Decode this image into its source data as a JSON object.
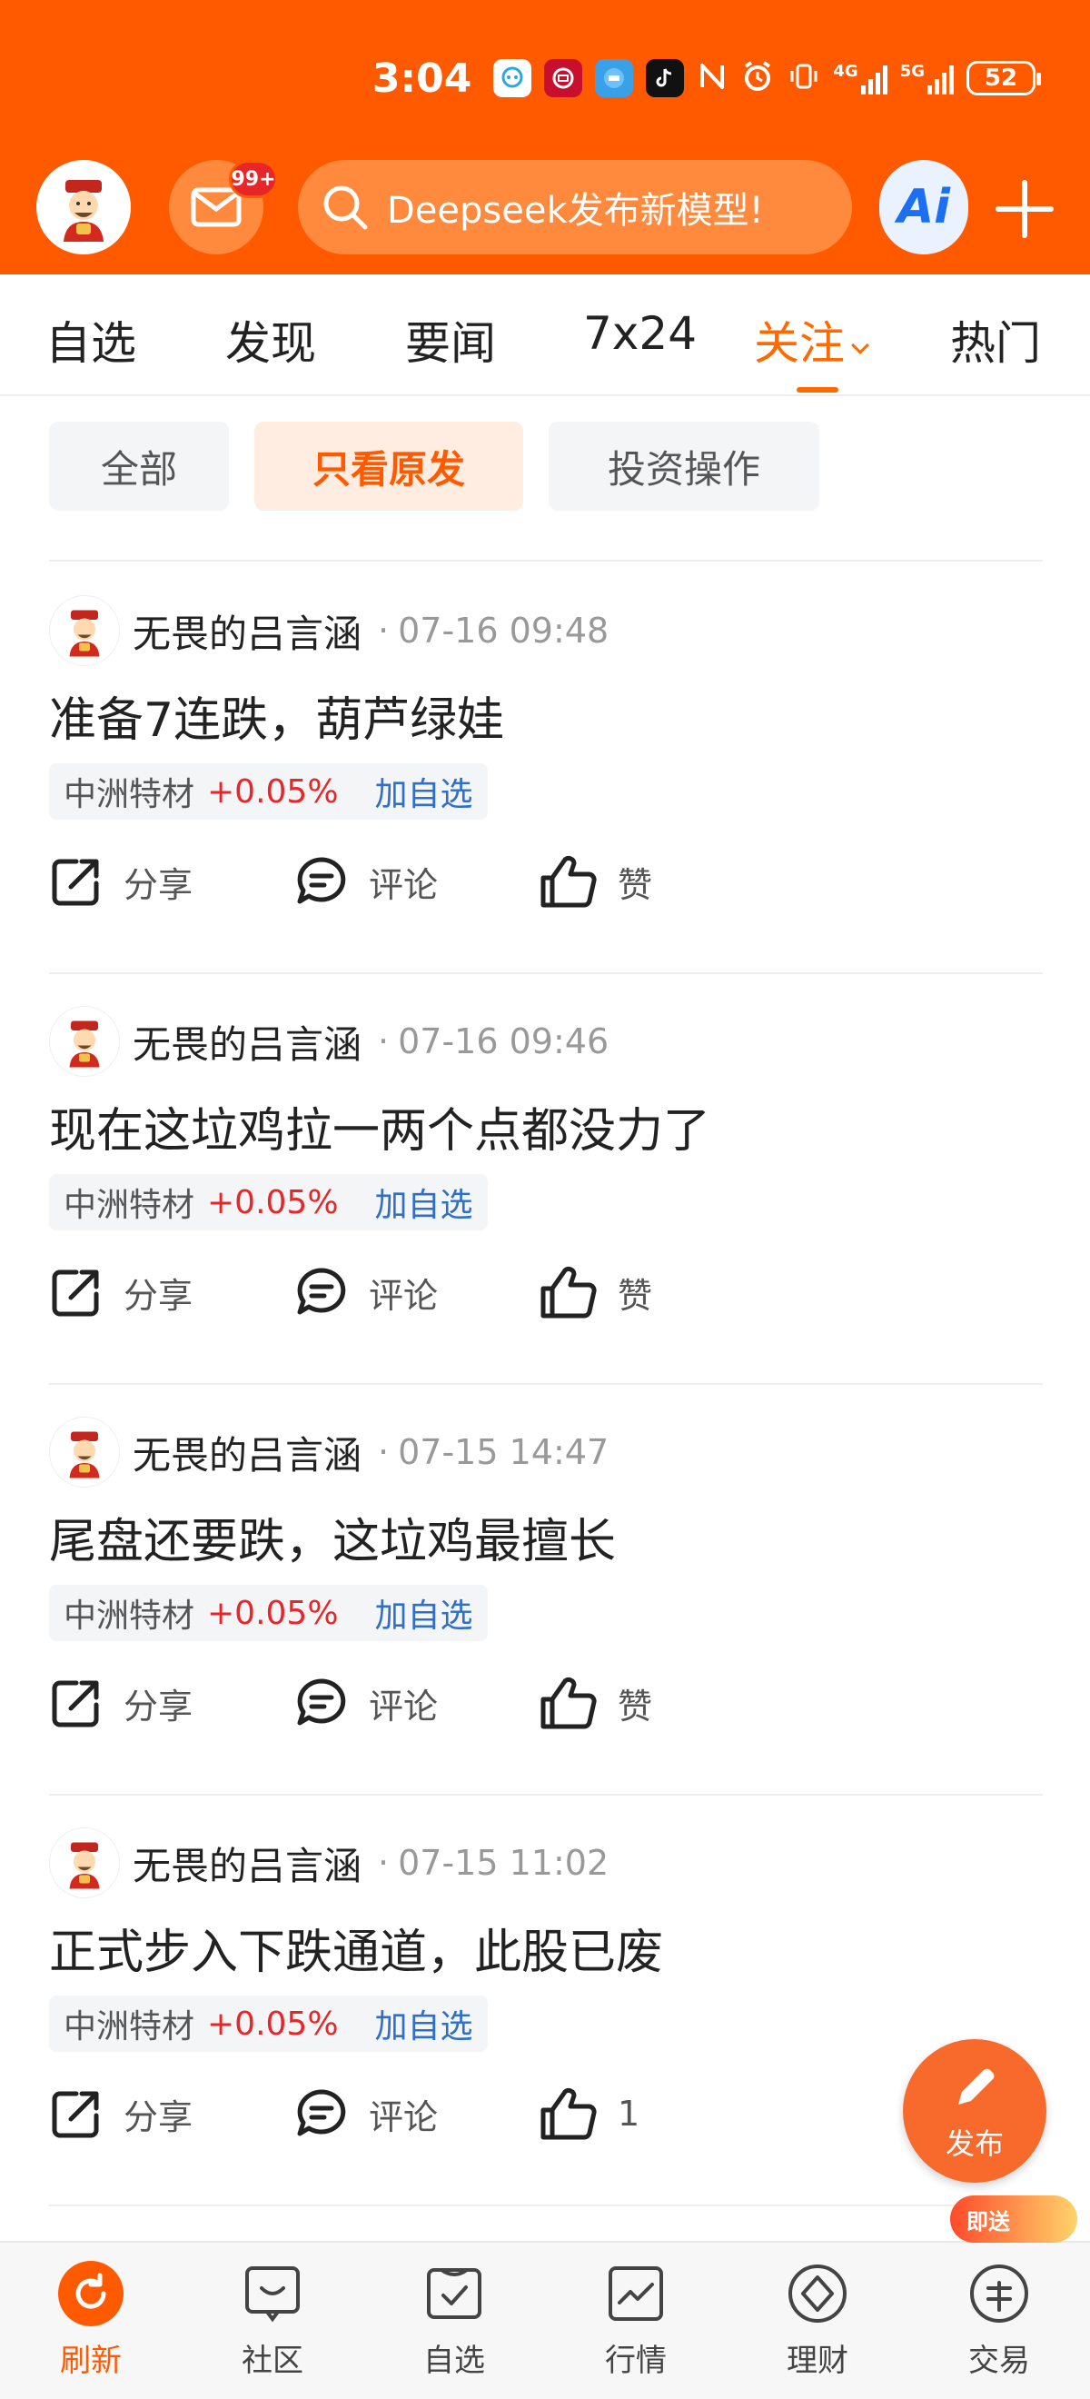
{
  "status_bar": {
    "time": "3:04",
    "network": "4G",
    "network2": "5G",
    "battery": "52"
  },
  "header": {
    "mail_badge": "99+",
    "search_placeholder": "Deepseek发布新模型!",
    "ai_label": "Ai"
  },
  "tabs": [
    {
      "label": "自选"
    },
    {
      "label": "发现"
    },
    {
      "label": "要闻"
    },
    {
      "label": "7x24"
    },
    {
      "label": "关注"
    },
    {
      "label": "热门"
    }
  ],
  "filters": [
    {
      "label": "全部"
    },
    {
      "label": "只看原发"
    },
    {
      "label": "投资操作"
    }
  ],
  "posts": [
    {
      "author": "无畏的吕言涵",
      "time": "07-16 09:48",
      "title": "准备7连跌，葫芦绿娃",
      "stock": "中洲特材",
      "change": "+0.05%",
      "add": "加自选",
      "share": "分享",
      "comment": "评论",
      "like": "赞"
    },
    {
      "author": "无畏的吕言涵",
      "time": "07-16 09:46",
      "title": "现在这垃鸡拉一两个点都没力了",
      "stock": "中洲特材",
      "change": "+0.05%",
      "add": "加自选",
      "share": "分享",
      "comment": "评论",
      "like": "赞"
    },
    {
      "author": "无畏的吕言涵",
      "time": "07-15 14:47",
      "title": "尾盘还要跌，这垃鸡最擅长",
      "stock": "中洲特材",
      "change": "+0.05%",
      "add": "加自选",
      "share": "分享",
      "comment": "评论",
      "like": "赞"
    },
    {
      "author": "无畏的吕言涵",
      "time": "07-15 11:02",
      "title": "正式步入下跌通道，此股已废",
      "stock": "中洲特材",
      "change": "+0.05%",
      "add": "加自选",
      "share": "分享",
      "comment": "评论",
      "like": "1"
    }
  ],
  "fab": {
    "label": "发布"
  },
  "bottom_nav": [
    {
      "label": "刷新",
      "icon": "refresh-icon"
    },
    {
      "label": "社区",
      "icon": "community-icon"
    },
    {
      "label": "自选",
      "icon": "watchlist-icon"
    },
    {
      "label": "行情",
      "icon": "market-icon"
    },
    {
      "label": "理财",
      "icon": "finance-icon"
    },
    {
      "label": "交易",
      "icon": "trade-icon"
    }
  ],
  "promo_badge": "即送",
  "colors": {
    "brand": "#ff5a00",
    "rise": "#e8262a",
    "link": "#2f6fc9"
  }
}
